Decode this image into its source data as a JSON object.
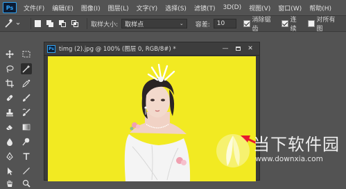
{
  "app": {
    "logo_text": "Ps"
  },
  "menu": [
    "文件(F)",
    "编辑(E)",
    "图像(I)",
    "图层(L)",
    "文字(Y)",
    "选择(S)",
    "滤镜(T)",
    "3D(D)",
    "视图(V)",
    "窗口(W)",
    "帮助(H)"
  ],
  "options": {
    "sample_size_label": "取样大小:",
    "sample_size_value": "取样点",
    "tolerance_label": "容差:",
    "tolerance_value": "10",
    "antialias_label": "消除锯齿",
    "contiguous_label": "连续",
    "all_layers_label": "对所有图"
  },
  "document": {
    "title": "timg (2).jpg @ 100% (图层 0, RGB/8#) *",
    "ps_badge": "Ps",
    "canvas_color": "#f2ea22"
  },
  "watermark": {
    "text": "当下软件园",
    "url": "www.downxia.com"
  },
  "colors": {
    "panel": "#535353",
    "options_bar": "#4a4a4a",
    "arrow": "#e8192c",
    "accent": "#31a8ff"
  },
  "icons": {
    "toolbar": [
      "move-icon",
      "marquee-icon",
      "lasso-icon",
      "magic-wand-icon",
      "crop-icon",
      "eyedropper-icon",
      "healing-brush-icon",
      "brush-icon",
      "stamp-icon",
      "history-brush-icon",
      "eraser-icon",
      "gradient-icon",
      "blur-icon",
      "dodge-icon",
      "pen-icon",
      "type-icon",
      "path-select-icon",
      "line-icon",
      "hand-icon",
      "zoom-icon"
    ]
  }
}
